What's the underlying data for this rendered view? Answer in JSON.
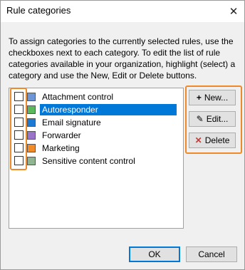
{
  "window": {
    "title": "Rule categories",
    "close_glyph": "✕"
  },
  "instructions": "To assign categories to the currently selected rules, use the checkboxes next to each category. To edit the list of rule categories available in your organization, highlight (select) a category and use the New, Edit or Delete buttons.",
  "categories": [
    {
      "label": "Attachment control",
      "color": "#6e96d6",
      "checked": false,
      "selected": false
    },
    {
      "label": "Autoresponder",
      "color": "#5cb85c",
      "checked": false,
      "selected": true
    },
    {
      "label": "Email signature",
      "color": "#1a7ad4",
      "checked": false,
      "selected": false
    },
    {
      "label": "Forwarder",
      "color": "#9a74c9",
      "checked": false,
      "selected": false
    },
    {
      "label": "Marketing",
      "color": "#f08c2a",
      "checked": false,
      "selected": false
    },
    {
      "label": "Sensitive content control",
      "color": "#8fb68f",
      "checked": false,
      "selected": false
    }
  ],
  "buttons": {
    "new": {
      "label": "New...",
      "icon": "plus-icon",
      "glyph": "+"
    },
    "edit": {
      "label": "Edit...",
      "icon": "pencil-icon",
      "glyph": "✎"
    },
    "delete": {
      "label": "Delete",
      "icon": "x-icon",
      "glyph": "✕",
      "glyph_color": "#d9312b"
    },
    "ok": {
      "label": "OK"
    },
    "cancel": {
      "label": "Cancel"
    }
  },
  "highlight_color": "#ee8a2a"
}
